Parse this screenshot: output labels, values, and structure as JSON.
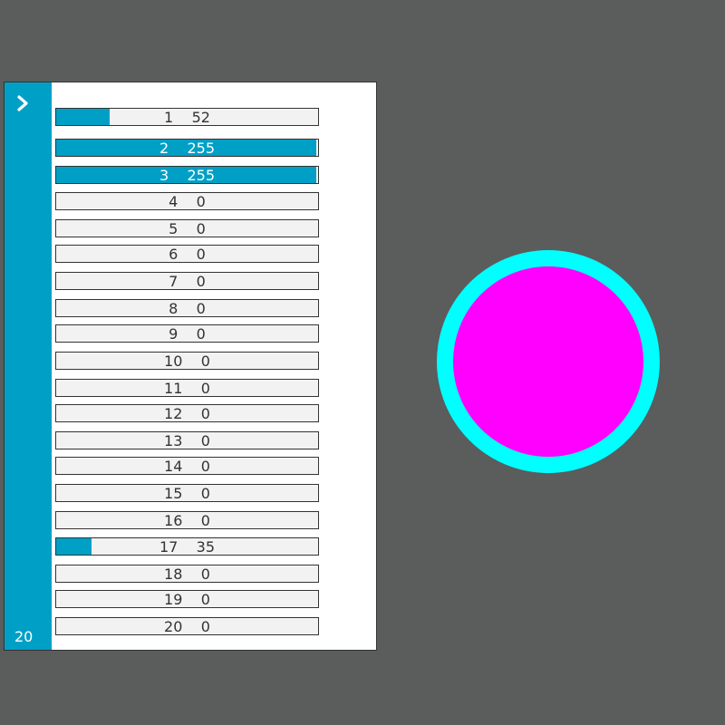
{
  "colors": {
    "background": "#5b5c5c",
    "panel": "#ffffff",
    "accent": "#00a0c6",
    "bar_track": "#f2f2f2",
    "ring": "#00ffff",
    "disc": "#ff00ff"
  },
  "sidebar": {
    "toggle_icon": "chevron-right-icon",
    "count": "20"
  },
  "channels": [
    {
      "index": "1",
      "value": "52",
      "level": 52
    },
    {
      "index": "2",
      "value": "255",
      "level": 255
    },
    {
      "index": "3",
      "value": "255",
      "level": 255
    },
    {
      "index": "4",
      "value": "0",
      "level": 0
    },
    {
      "index": "5",
      "value": "0",
      "level": 0
    },
    {
      "index": "6",
      "value": "0",
      "level": 0
    },
    {
      "index": "7",
      "value": "0",
      "level": 0
    },
    {
      "index": "8",
      "value": "0",
      "level": 0
    },
    {
      "index": "9",
      "value": "0",
      "level": 0
    },
    {
      "index": "10",
      "value": "0",
      "level": 0
    },
    {
      "index": "11",
      "value": "0",
      "level": 0
    },
    {
      "index": "12",
      "value": "0",
      "level": 0
    },
    {
      "index": "13",
      "value": "0",
      "level": 0
    },
    {
      "index": "14",
      "value": "0",
      "level": 0
    },
    {
      "index": "15",
      "value": "0",
      "level": 0
    },
    {
      "index": "16",
      "value": "0",
      "level": 0
    },
    {
      "index": "17",
      "value": "35",
      "level": 35
    },
    {
      "index": "18",
      "value": "0",
      "level": 0
    },
    {
      "index": "19",
      "value": "0",
      "level": 0
    },
    {
      "index": "20",
      "value": "0",
      "level": 0
    }
  ],
  "max_level": 255
}
